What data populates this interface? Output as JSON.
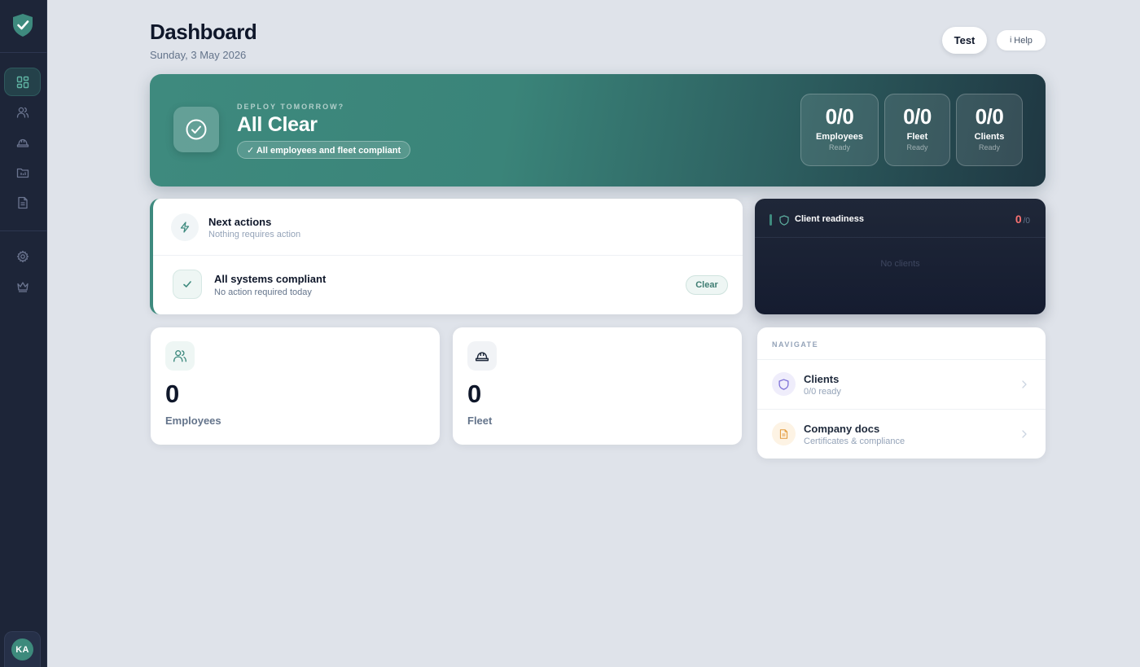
{
  "sidebar": {
    "items": [
      {
        "name": "dashboard-icon",
        "active": true
      },
      {
        "name": "users-icon",
        "active": false
      },
      {
        "name": "hardhat-icon",
        "active": false
      },
      {
        "name": "folder-icon",
        "active": false
      },
      {
        "name": "document-icon",
        "active": false
      },
      {
        "name": "gear-icon",
        "active": false
      },
      {
        "name": "crown-icon",
        "active": false
      }
    ],
    "avatar_initials": "KA"
  },
  "header": {
    "title": "Dashboard",
    "date": "Sunday, 3 May 2026",
    "test_label": "Test",
    "help_icon": "i",
    "help_label": "Help"
  },
  "hero": {
    "eyebrow": "DEPLOY TOMORROW?",
    "title": "All Clear",
    "pill": "✓ All employees and fleet compliant",
    "stats": [
      {
        "value": "0/0",
        "label": "Employees",
        "sub": "Ready"
      },
      {
        "value": "0/0",
        "label": "Fleet",
        "sub": "Ready"
      },
      {
        "value": "0/0",
        "label": "Clients",
        "sub": "Ready"
      }
    ]
  },
  "next_actions": {
    "title": "Next actions",
    "subtitle": "Nothing requires action",
    "status_title": "All systems compliant",
    "status_subtitle": "No action required today",
    "clear_label": "Clear"
  },
  "client_readiness": {
    "title": "Client readiness",
    "count": "0",
    "total": "/0",
    "empty": "No clients"
  },
  "stat_cards": {
    "employees": {
      "value": "0",
      "label": "Employees"
    },
    "fleet": {
      "value": "0",
      "label": "Fleet"
    }
  },
  "navigate": {
    "eyebrow": "NAVIGATE",
    "items": [
      {
        "title": "Clients",
        "subtitle": "0/0 ready",
        "icon": "shield-icon"
      },
      {
        "title": "Company docs",
        "subtitle": "Certificates & compliance",
        "icon": "document-icon"
      }
    ]
  },
  "colors": {
    "accent": "#3e8a7e",
    "sidebar_bg": "#1d2538",
    "page_bg": "#dfe3ea",
    "alert": "#f87171"
  }
}
